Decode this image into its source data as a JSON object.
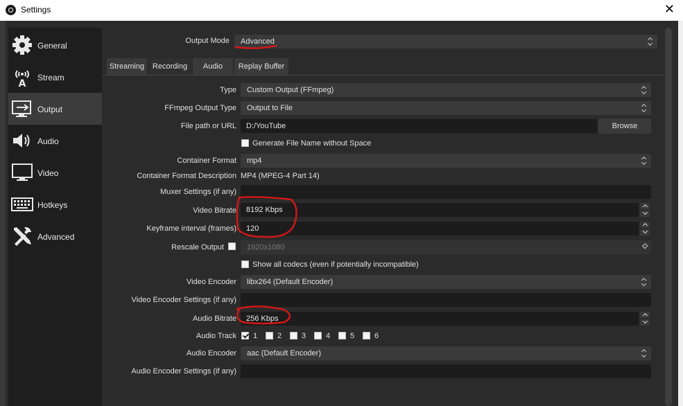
{
  "window": {
    "title": "Settings",
    "close_symbol": "✕"
  },
  "sidebar": {
    "items": [
      {
        "label": "General",
        "icon": "gear-icon"
      },
      {
        "label": "Stream",
        "icon": "antenna-icon"
      },
      {
        "label": "Output",
        "icon": "monitor-output-icon",
        "active": true
      },
      {
        "label": "Audio",
        "icon": "speaker-icon"
      },
      {
        "label": "Video",
        "icon": "monitor-icon"
      },
      {
        "label": "Hotkeys",
        "icon": "keyboard-icon"
      },
      {
        "label": "Advanced",
        "icon": "tools-icon"
      }
    ]
  },
  "output_mode": {
    "label": "Output Mode",
    "value": "Advanced"
  },
  "tabs": [
    "Streaming",
    "Recording",
    "Audio",
    "Replay Buffer"
  ],
  "active_tab": "Recording",
  "form": {
    "type": {
      "label": "Type",
      "value": "Custom Output (FFmpeg)"
    },
    "ffmpeg_output_type": {
      "label": "FFmpeg Output Type",
      "value": "Output to File"
    },
    "file_path": {
      "label": "File path or URL",
      "value": "D:/YouTube",
      "browse": "Browse"
    },
    "generate_name": {
      "label": "Generate File Name without Space",
      "checked": false
    },
    "container_format": {
      "label": "Container Format",
      "value": "mp4"
    },
    "container_desc": {
      "label": "Container Format Description",
      "value": "MP4 (MPEG-4 Part 14)"
    },
    "muxer_settings": {
      "label": "Muxer Settings (if any)",
      "value": ""
    },
    "video_bitrate": {
      "label": "Video Bitrate",
      "value": "8192 Kbps"
    },
    "keyframe_interval": {
      "label": "Keyframe interval (frames)",
      "value": "120"
    },
    "rescale_output": {
      "label": "Rescale Output",
      "checked": false,
      "value": "1920x1080"
    },
    "show_all_codecs": {
      "label": "Show all codecs (even if potentially incompatible)",
      "checked": false
    },
    "video_encoder": {
      "label": "Video Encoder",
      "value": "libx264 (Default Encoder)"
    },
    "video_encoder_settings": {
      "label": "Video Encoder Settings (if any)",
      "value": ""
    },
    "audio_bitrate": {
      "label": "Audio Bitrate",
      "value": "256 Kbps"
    },
    "audio_track": {
      "label": "Audio Track",
      "tracks": [
        {
          "n": "1",
          "checked": true
        },
        {
          "n": "2",
          "checked": false
        },
        {
          "n": "3",
          "checked": false
        },
        {
          "n": "4",
          "checked": false
        },
        {
          "n": "5",
          "checked": false
        },
        {
          "n": "6",
          "checked": false
        }
      ]
    },
    "audio_encoder": {
      "label": "Audio Encoder",
      "value": "aac (Default Encoder)"
    },
    "audio_encoder_settings": {
      "label": "Audio Encoder Settings (if any)",
      "value": ""
    }
  },
  "annotation_color": "#d01818"
}
